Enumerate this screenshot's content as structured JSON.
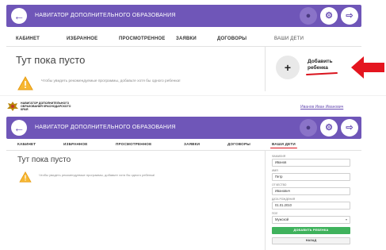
{
  "app": {
    "title": "НАВИГАТОР ДОПОЛНИТЕЛЬНОГО ОБРАЗОВАНИЯ"
  },
  "tabs": [
    {
      "label": "КАБИНЕТ"
    },
    {
      "label": "ИЗБРАННОЕ"
    },
    {
      "label": "ПРОСМОТРЕННОЕ"
    },
    {
      "label": "ЗАЯВКИ"
    },
    {
      "label": "ДОГОВОРЫ"
    },
    {
      "label": "ВАШИ ДЕТИ"
    }
  ],
  "empty": {
    "title": "Тут пока пусто",
    "note": "Чтобы увидеть рекомендуемые программы, добавьте хотя бы одного ребенка!"
  },
  "add_child": {
    "line1": "Добавить",
    "line2": "ребенка",
    "plus": "+"
  },
  "brand": {
    "line1": "НАВИГАТОР ДОПОЛНИТЕЛЬНОГО",
    "line2": "ОБРАЗОВАНИЯ КРАСНОДАРСКОГО",
    "line3": "КРАЯ"
  },
  "user": {
    "name": "Иванов Иван Иванович"
  },
  "form": {
    "surname_label": "ФАМИЛИЯ",
    "surname_value": "Иванов",
    "name_label": "ИМЯ",
    "name_value": "Петр",
    "patronymic_label": "ОТЧЕСТВО",
    "patronymic_value": "Иванович",
    "birthdate_label": "ДАТА РОЖДЕНИЯ",
    "birthdate_value": "01.01.2010",
    "gender_label": "ПОЛ",
    "gender_value": "Мужской",
    "submit_label": "ДОБАВИТЬ РЕБЕНКА",
    "back_label": "НАЗАД"
  },
  "icons": {
    "back": "arrow-left-icon",
    "user": "user-icon",
    "settings": "settings-icon",
    "logout": "logout-icon",
    "warning": "warning-icon",
    "plus": "plus-icon",
    "arrow": "red-arrow-icon",
    "crest": "crest-logo"
  },
  "colors": {
    "primary": "#6f56b8",
    "accent_red": "#d9141e",
    "success": "#3fb25c",
    "warning": "#f4a81c"
  }
}
